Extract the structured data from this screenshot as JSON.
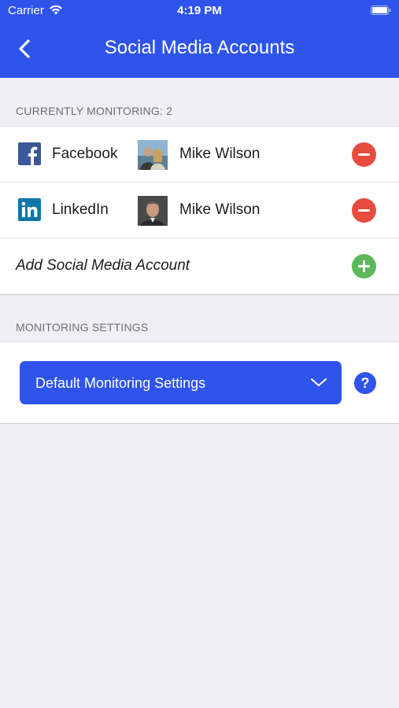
{
  "status_bar": {
    "carrier": "Carrier",
    "time": "4:19 PM"
  },
  "nav": {
    "title": "Social Media Accounts"
  },
  "monitoring": {
    "header": "CURRENTLY MONITORING: 2",
    "accounts": [
      {
        "platform": "Facebook",
        "user": "Mike Wilson"
      },
      {
        "platform": "LinkedIn",
        "user": "Mike Wilson"
      }
    ],
    "add_label": "Add Social Media Account"
  },
  "settings": {
    "header": "MONITORING SETTINGS",
    "selected": "Default Monitoring Settings",
    "help_symbol": "?"
  },
  "colors": {
    "brand": "#2f54eb",
    "remove": "#e74c3c",
    "add": "#5cb85c",
    "facebook": "#3b5998",
    "linkedin": "#0e76a8"
  }
}
